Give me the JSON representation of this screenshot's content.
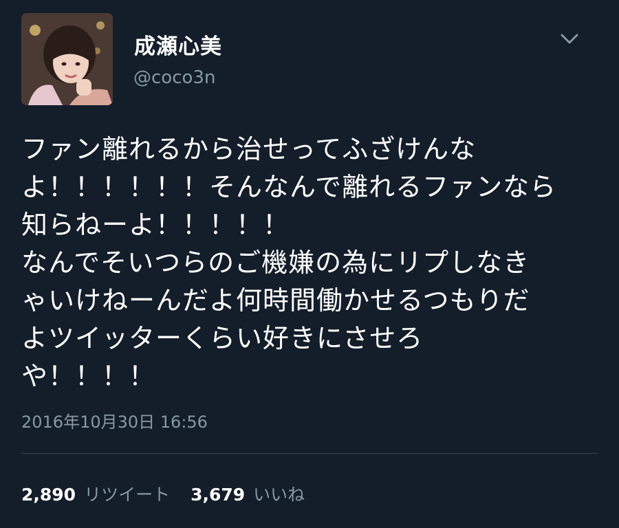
{
  "user": {
    "display_name": "成瀬心美",
    "handle": "@coco3n"
  },
  "tweet": {
    "text": "ファン離れるから治せってふざけんな\nよ！！！！！！そんなんで離れるファンなら\n知らねーよ！！！！！\nなんでそいつらのご機嫌の為にリプしなき\nゃいけねーんだよ何時間働かせるつもりだ\nよツイッターくらい好きにさせろ\nや！！！！",
    "timestamp": "2016年10月30日 16:56"
  },
  "stats": {
    "retweets_count": "2,890",
    "retweets_label": "リツイート",
    "likes_count": "3,679",
    "likes_label": "いいね"
  },
  "icons": {
    "menu": "chevron-down-icon",
    "avatar": "profile-photo"
  },
  "colors": {
    "background": "#141d2a",
    "secondary_text": "#8899a6",
    "divider": "#38444d"
  }
}
